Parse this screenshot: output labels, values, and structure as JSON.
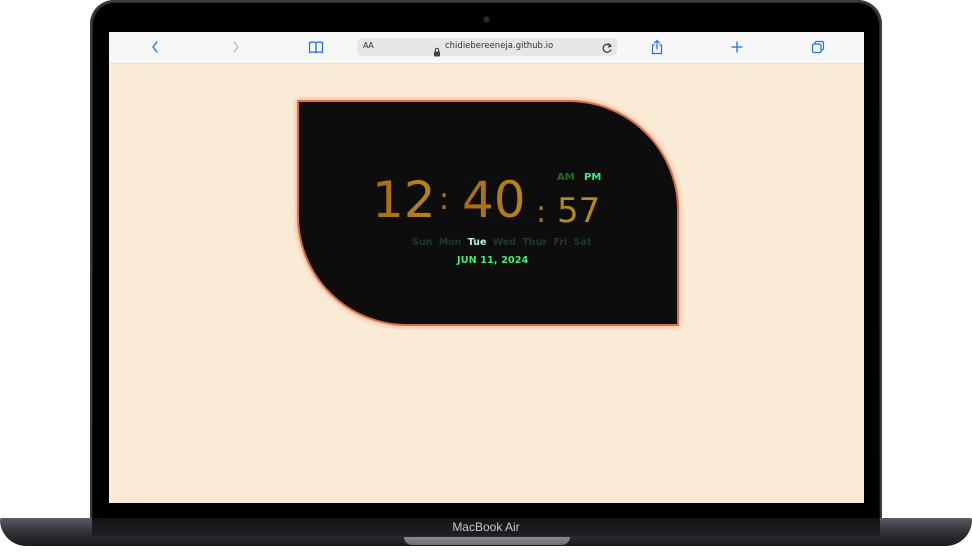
{
  "browser": {
    "reader_label": "AA",
    "url": "chidiebereeneja.github.io",
    "icons": {
      "back": "chevron-left-icon",
      "forward": "chevron-right-icon",
      "bookmarks": "book-icon",
      "lock": "lock-icon",
      "reload": "reload-icon",
      "share": "share-icon",
      "new_tab": "plus-icon",
      "tabs": "tabs-overview-icon"
    }
  },
  "clock": {
    "hours": "12",
    "minutes": "40",
    "seconds": "57",
    "separator": ":",
    "am_label": "AM",
    "pm_label": "PM",
    "active_period": "PM",
    "days": [
      "Sun",
      "Mon",
      "Tue",
      "Wed",
      "Thur",
      "Fri",
      "Sat"
    ],
    "active_day": "Tue",
    "date": "JUN 11, 2024"
  },
  "device": {
    "label": "MacBook Air"
  },
  "colors": {
    "page_background": "#faebd7",
    "card_background": "#0d0d0d",
    "card_border": "#d9704a",
    "digit_color": "#b48a1c",
    "accent_green": "#3ef07a",
    "inactive_green": "#1e3a25",
    "browser_accent": "#1a73e8"
  }
}
